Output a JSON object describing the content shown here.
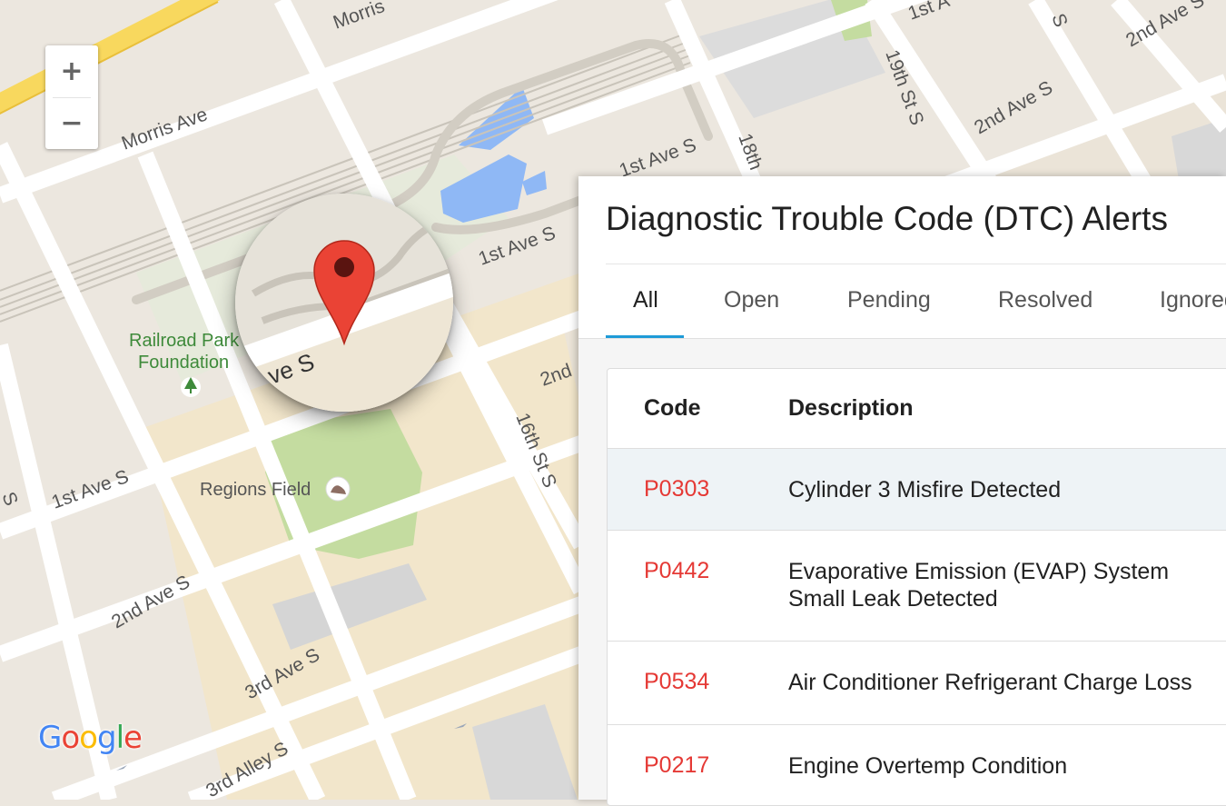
{
  "map": {
    "zoom_in_label": "+",
    "zoom_out_label": "−",
    "logo_letters": [
      {
        "ch": "G",
        "color": "#4285F4"
      },
      {
        "ch": "o",
        "color": "#EA4335"
      },
      {
        "ch": "o",
        "color": "#FBBC05"
      },
      {
        "ch": "g",
        "color": "#4285F4"
      },
      {
        "ch": "l",
        "color": "#34A853"
      },
      {
        "ch": "e",
        "color": "#EA4335"
      }
    ],
    "street_labels": {
      "morris_top": "Morris",
      "morris_ave": "Morris Ave",
      "first_ave_s_top": "1st A",
      "nineteenth": "19th St S",
      "s_top": "S",
      "second_ave_s_right": "2nd Ave S",
      "second_ave_s_topright": "2nd Ave S",
      "eighteenth": "18th",
      "first_ave_s_mid": "1st Ave S",
      "first_ave_s_center": "1st Ave S",
      "second_mid": "2nd",
      "sixteenth": "16th St S",
      "first_ave_s_left": "1st Ave S",
      "s_left": "S",
      "second_ave_s_left": "2nd Ave S",
      "third_ave_s": "3rd Ave S",
      "third_alley_s": "3rd Alley S",
      "lens_text": "ve S"
    },
    "poi": {
      "park_line1": "Railroad Park",
      "park_line2": "Foundation",
      "stadium": "Regions Field"
    },
    "colors": {
      "pin": "#ea4335",
      "water": "#8fb8f5",
      "park": "#c4dca0"
    }
  },
  "panel": {
    "title": "Diagnostic Trouble Code (DTC) Alerts",
    "tabs": [
      {
        "label": "All",
        "active": true
      },
      {
        "label": "Open",
        "active": false
      },
      {
        "label": "Pending",
        "active": false
      },
      {
        "label": "Resolved",
        "active": false
      },
      {
        "label": "Ignored",
        "active": false
      }
    ],
    "accent_color": "#1e9bd7",
    "code_color": "#e53935",
    "table": {
      "columns": [
        "Code",
        "Description"
      ],
      "rows": [
        {
          "code": "P0303",
          "description": "Cylinder 3 Misfire Detected"
        },
        {
          "code": "P0442",
          "description": "Evaporative Emission (EVAP) System Small Leak Detected"
        },
        {
          "code": "P0534",
          "description": "Air Conditioner Refrigerant Charge Loss"
        },
        {
          "code": "P0217",
          "description": "Engine Overtemp Condition"
        }
      ]
    }
  }
}
